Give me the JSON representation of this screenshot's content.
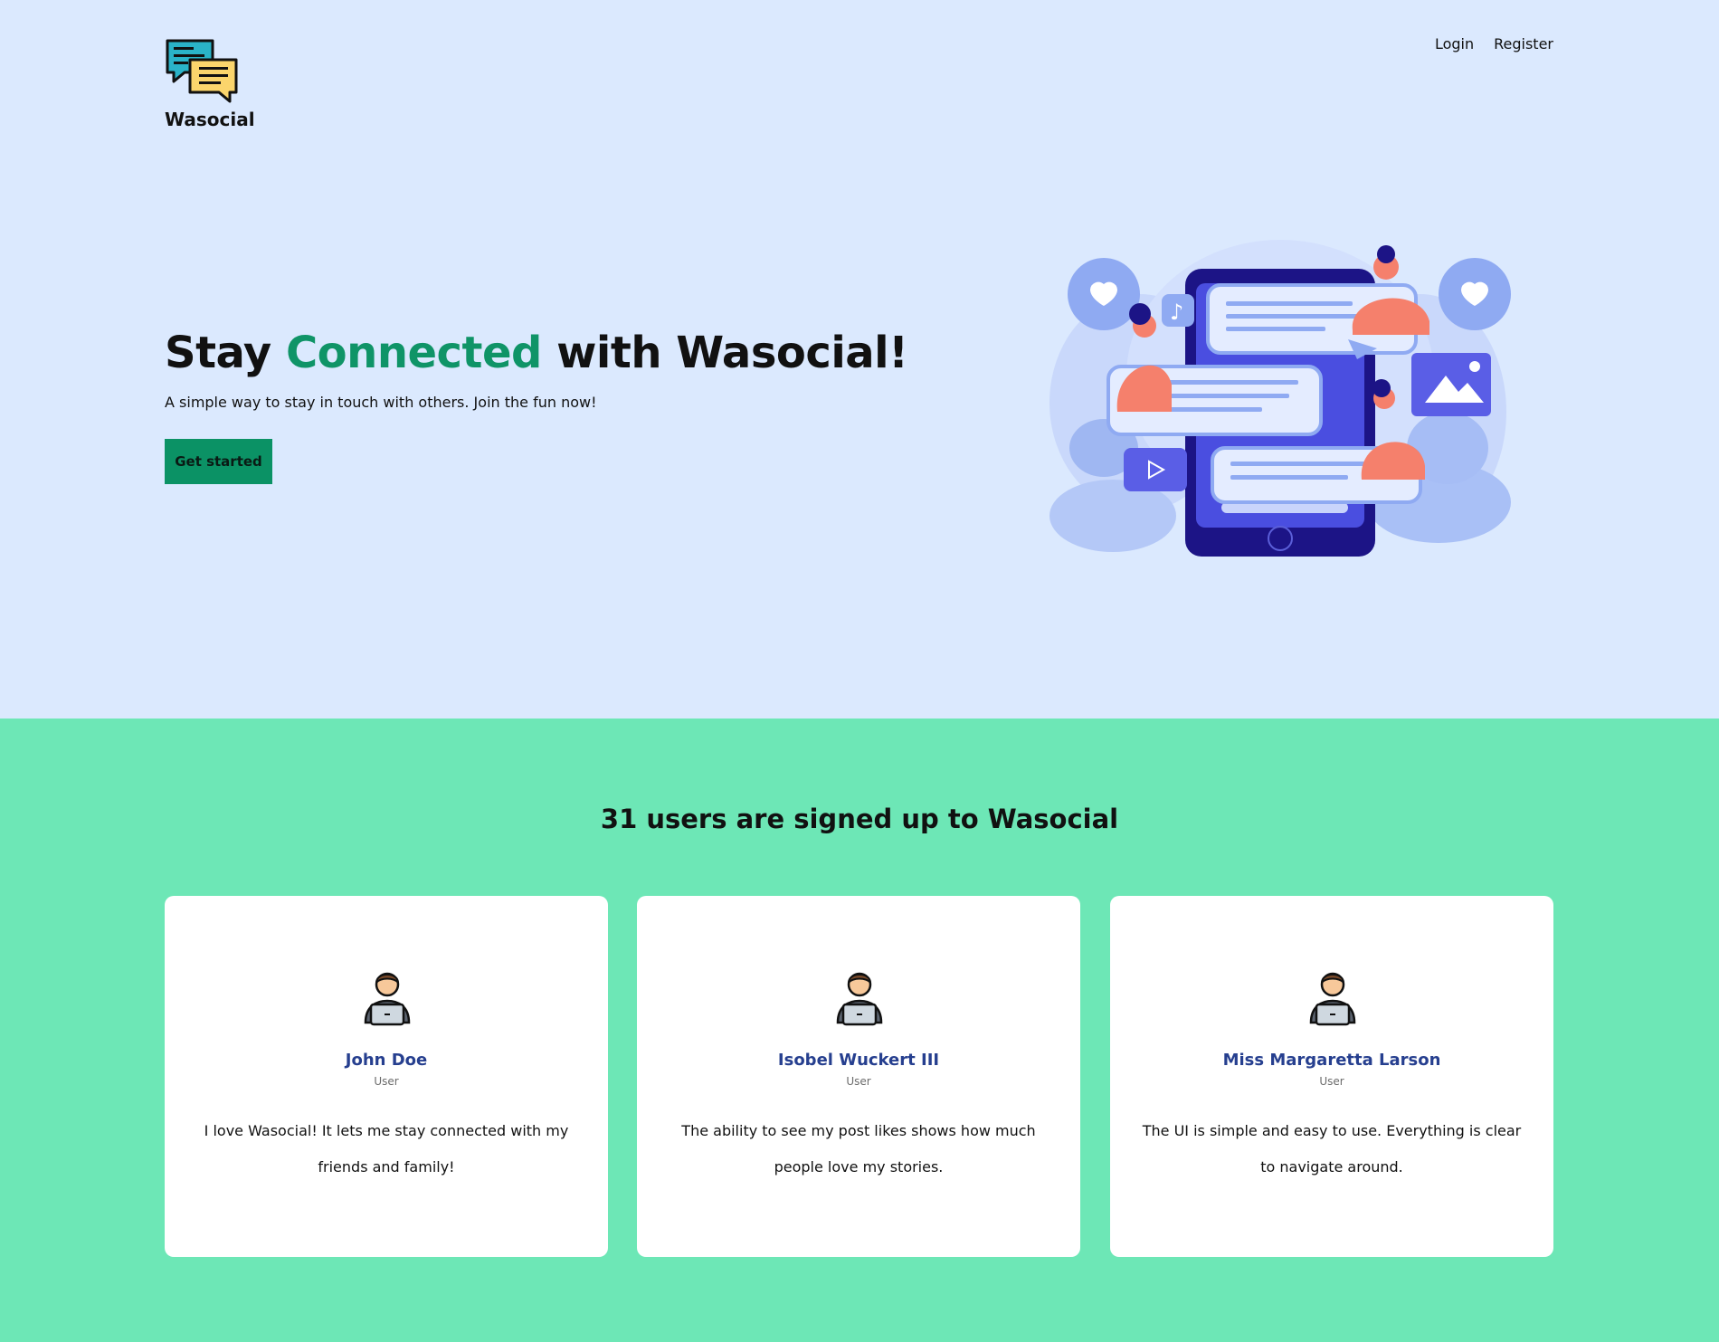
{
  "brand": {
    "name": "Wasocial",
    "logo_icon": "chat-bubbles-icon"
  },
  "nav": {
    "login": "Login",
    "register": "Register"
  },
  "hero": {
    "title_start": "Stay ",
    "title_accent": "Connected",
    "title_end": " with Wasocial!",
    "subtitle": "A simple way to stay in touch with others. Join the fun now!",
    "cta": "Get started",
    "illustration_icon": "social-chat-illustration"
  },
  "testimonials": {
    "heading": "31 users are signed up to Wasocial",
    "cards": [
      {
        "name": "John Doe",
        "role": "User",
        "quote": "I love Wasocial! It lets me stay connected with my friends and family!",
        "avatar_icon": "user-laptop-icon"
      },
      {
        "name": "Isobel Wuckert III",
        "role": "User",
        "quote": "The ability to see my post likes shows how much people love my stories.",
        "avatar_icon": "user-laptop-icon"
      },
      {
        "name": "Miss Margaretta Larson",
        "role": "User",
        "quote": "The UI is simple and easy to use. Everything is clear to navigate around.",
        "avatar_icon": "user-laptop-icon"
      }
    ]
  },
  "colors": {
    "hero_bg": "#dbe9fe",
    "section_bg": "#6de7b6",
    "accent": "#0f9467",
    "button": "#0b9265",
    "name": "#263f8f"
  }
}
